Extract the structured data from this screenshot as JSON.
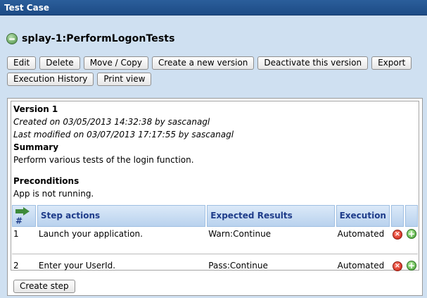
{
  "window": {
    "title": "Test Case"
  },
  "header": {
    "title": "splay-1:PerformLogonTests"
  },
  "toolbar": {
    "row1": [
      "Edit",
      "Delete",
      "Move / Copy",
      "Create a new version",
      "Deactivate this version",
      "Export"
    ],
    "row2": [
      "Execution History",
      "Print view"
    ]
  },
  "details": {
    "version": "Version 1",
    "created": "Created on 03/05/2013 14:32:38  by sascanagl",
    "modified": "Last modified on  03/07/2013 17:17:55  by sascanagl",
    "summary_label": "Summary",
    "summary_text": "Perform various tests of the login function.",
    "preconditions_label": "Preconditions",
    "preconditions_text": "App is not running."
  },
  "steps_table": {
    "headers": {
      "num": "#",
      "actions": "Step actions",
      "expected": "Expected Results",
      "execution": "Execution"
    },
    "rows": [
      {
        "num": "1",
        "action": "Launch your application.",
        "expected": "Warn:Continue",
        "execution": "Automated"
      },
      {
        "num": "2",
        "action": "Enter your UserId.",
        "expected": "Pass:Continue",
        "execution": "Automated"
      }
    ]
  },
  "create_step_label": "Create step",
  "icons": {
    "testcase": "testcase-icon",
    "reorder": "reorder-arrow-icon",
    "delete": "delete-step-icon",
    "add": "add-step-icon"
  },
  "colors": {
    "titlebar": "#1d4b86",
    "background": "#cfe0f1",
    "header_text": "#1e3c8a"
  }
}
